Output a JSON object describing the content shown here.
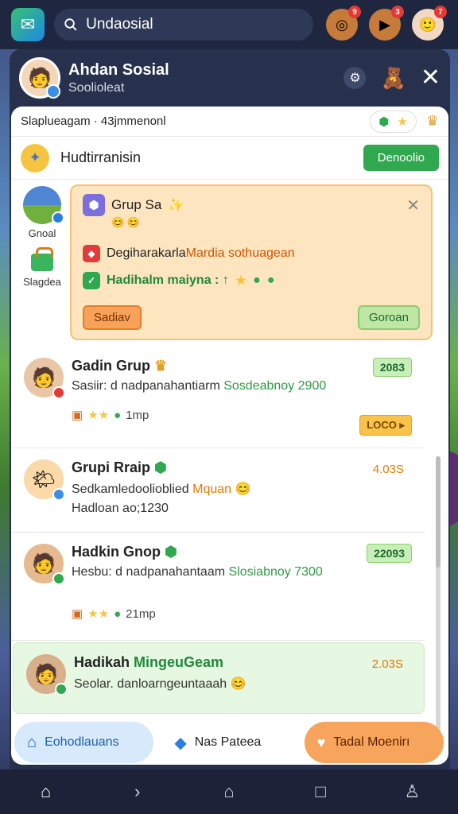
{
  "search": {
    "value": "Undaosial"
  },
  "top_icons": [
    {
      "icon": "target-icon",
      "badge": "9"
    },
    {
      "icon": "play-icon",
      "badge": "3"
    },
    {
      "icon": "avatar-icon",
      "badge": "7"
    }
  ],
  "profile": {
    "name": "Ahdan Sosial",
    "subtitle": "Soolioleat"
  },
  "sheet": {
    "header_text": "Slaplueagam · 43jmmenonl",
    "title_row_label": "Hudtirranisin",
    "title_row_button": "Denoolio"
  },
  "rail": [
    {
      "label": "Gnoal"
    },
    {
      "label": "Slagdea"
    }
  ],
  "popup": {
    "title": "Grup Sa",
    "line1_prefix": "Degiharakarla",
    "line1_highlight": "Mardia sothuagean",
    "line2": "Hadihalm maiyna : ↑",
    "button_left": "Sadiav",
    "button_right": "Goroan"
  },
  "items": [
    {
      "name": "Gadin Grup",
      "text": "Sasiir: d nadpanahantiarm",
      "accent": "Sosdeabnoy 2900",
      "meta": "1mp",
      "chip": "2083",
      "chip2": "LOCO"
    },
    {
      "name": "Grupi Rraip",
      "text": "Sedkamledoolioblied",
      "accent": "Mquan",
      "text2": "Hadloan ao;1230",
      "chip_text": "4.03S"
    },
    {
      "name": "Hadkin Gnop",
      "text": "Hesbu: d nadpanahantaam",
      "accent": "Slosiabnoy 7300",
      "meta": "21mp",
      "chip": "22093"
    },
    {
      "name": "Hadikah",
      "name_green": "MingeuGeam",
      "text": "Seolar. danloarngeuntaaah",
      "chip_text": "2.03S"
    }
  ],
  "actions": {
    "left": "Eohodlauans",
    "middle": "Nas Pateea",
    "right": "Tadal Moenirı"
  },
  "colors": {
    "green": "#2fa84f",
    "orange": "#f7a45c",
    "popup_bg": "#fde5bf",
    "top_bar": "#1f2740"
  }
}
